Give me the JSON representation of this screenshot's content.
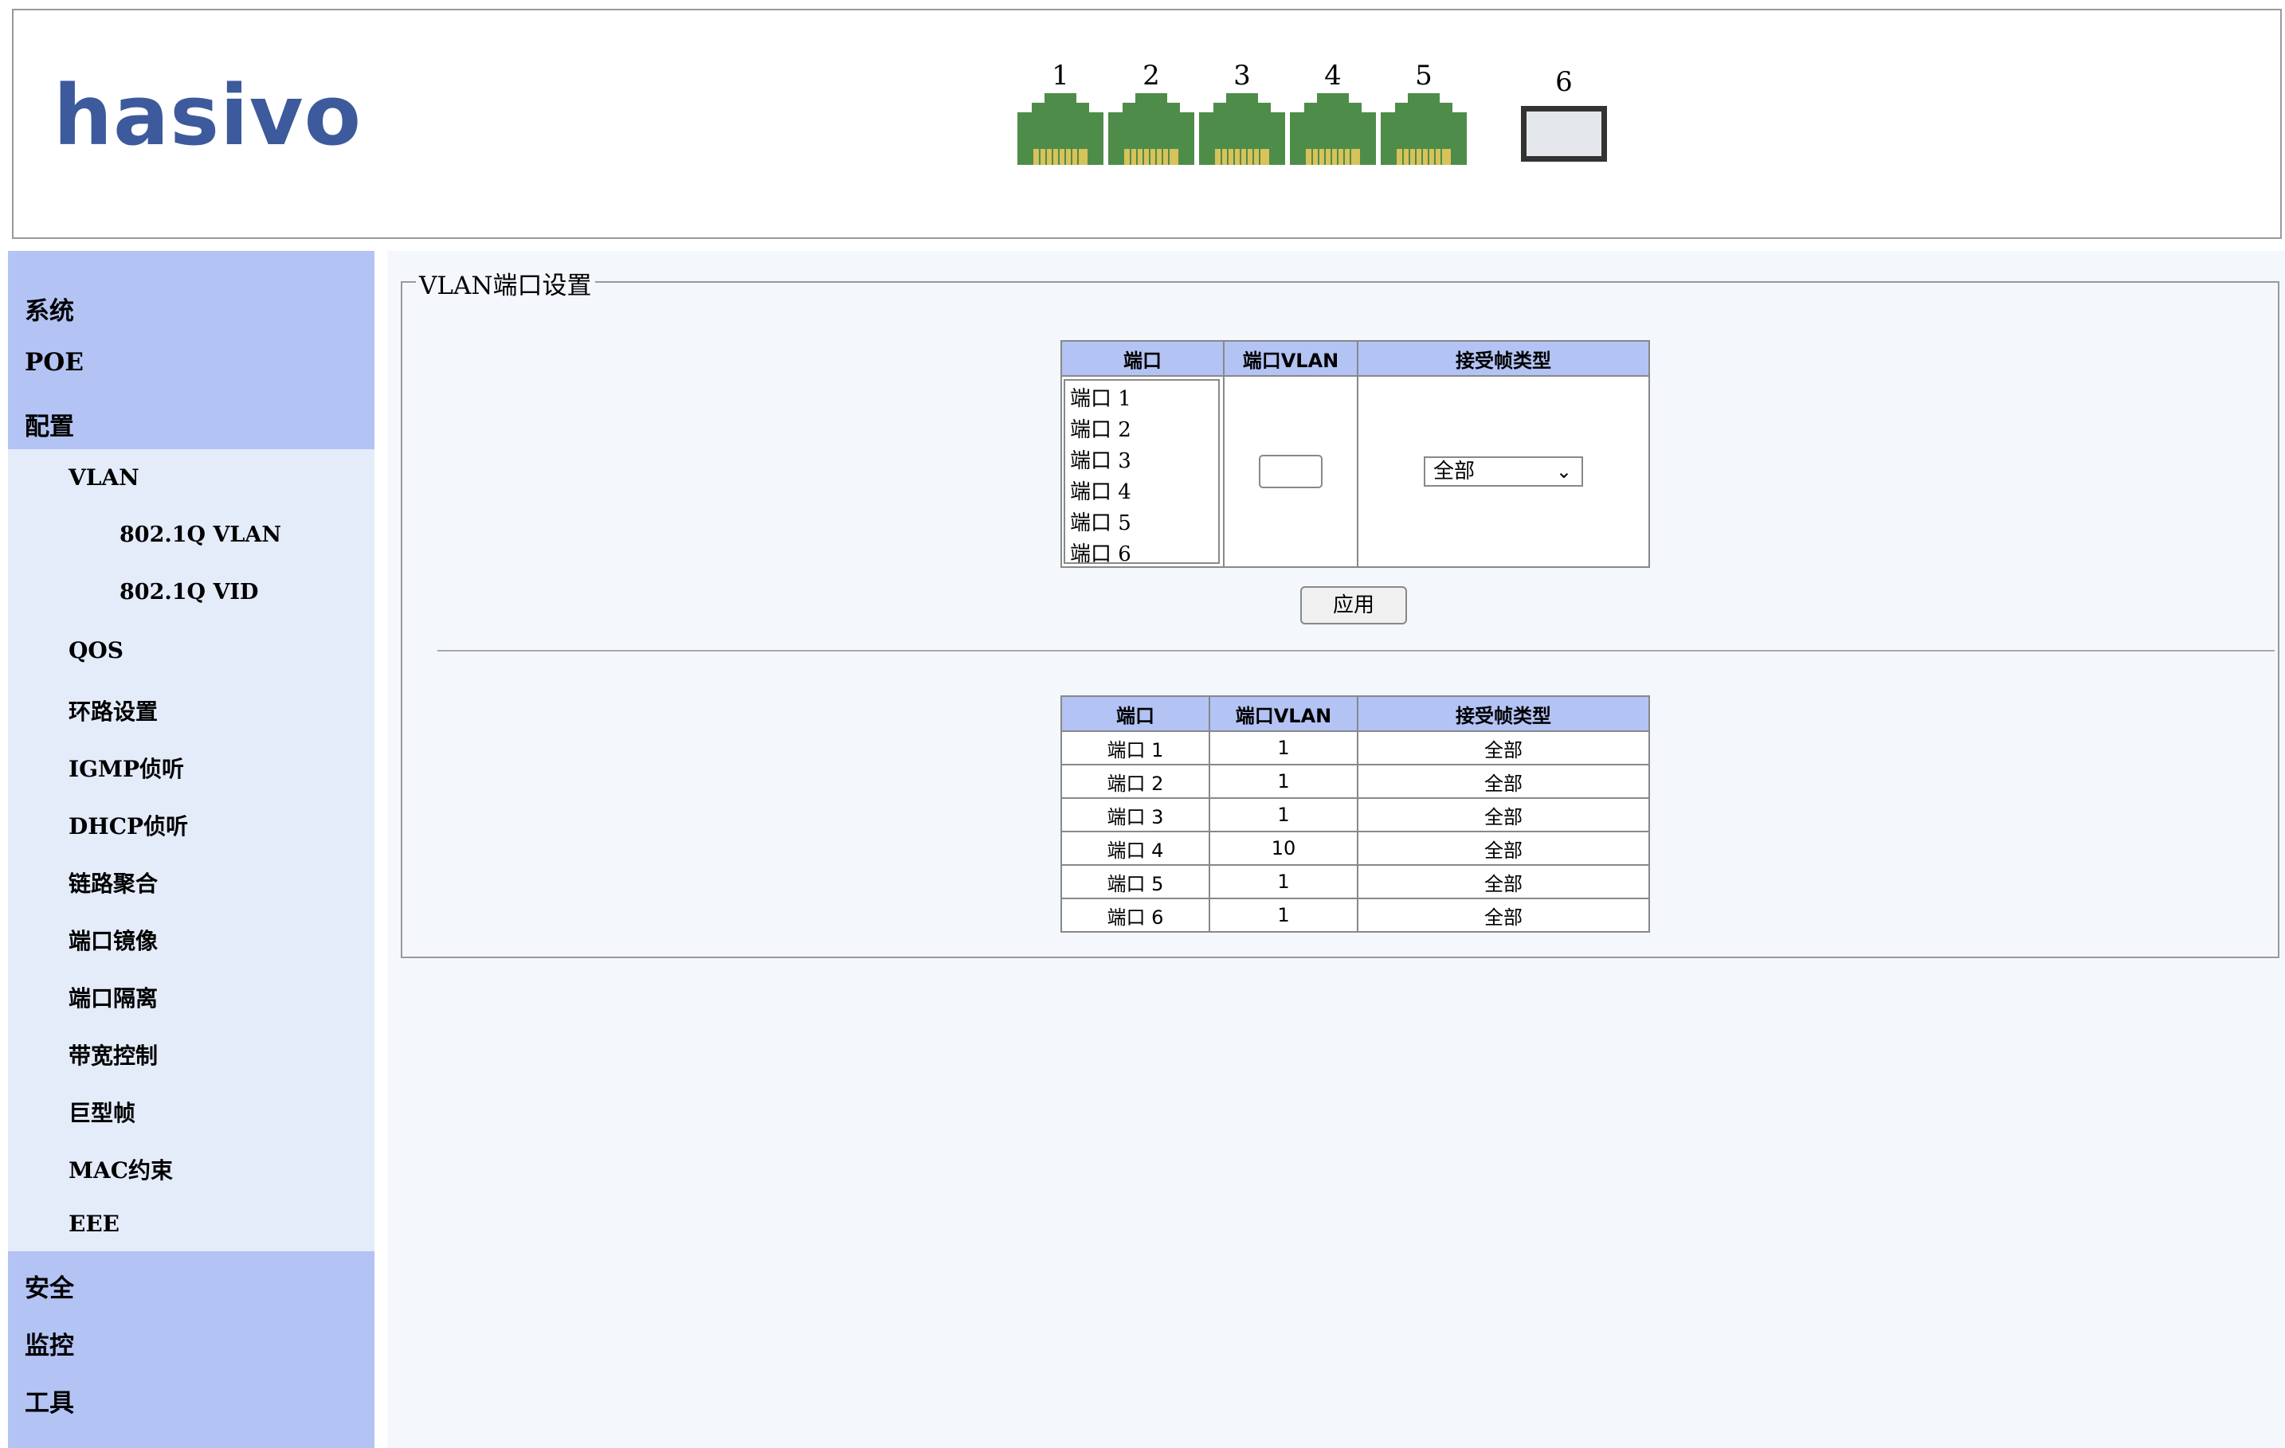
{
  "header": {
    "logo_text": "hasivo",
    "ports": [
      "1",
      "2",
      "3",
      "4",
      "5"
    ],
    "sfp_port": "6",
    "colors": {
      "rj45": "#4e8c4a",
      "pins": "#d8c25a"
    }
  },
  "sidebar": {
    "items": [
      {
        "label": "系统",
        "level": 1
      },
      {
        "label": "POE",
        "level": 1
      },
      {
        "label": "配置",
        "level": 1
      },
      {
        "label": "VLAN",
        "level": 2
      },
      {
        "label": "802.1Q VLAN",
        "level": 3
      },
      {
        "label": "802.1Q VID",
        "level": 3
      },
      {
        "label": "QOS",
        "level": 2
      },
      {
        "label": "环路设置",
        "level": 2
      },
      {
        "label": "IGMP侦听",
        "level": 2
      },
      {
        "label": "DHCP侦听",
        "level": 2
      },
      {
        "label": "链路聚合",
        "level": 2
      },
      {
        "label": "端口镜像",
        "level": 2
      },
      {
        "label": "端口隔离",
        "level": 2
      },
      {
        "label": "带宽控制",
        "level": 2
      },
      {
        "label": "巨型帧",
        "level": 2
      },
      {
        "label": "MAC约束",
        "level": 2
      },
      {
        "label": "EEE",
        "level": 2
      },
      {
        "label": "安全",
        "level": 1
      },
      {
        "label": "监控",
        "level": 1
      },
      {
        "label": "工具",
        "level": 1
      }
    ],
    "colors": {
      "section": "#b3c3f4",
      "sub": "#e4ebf9"
    }
  },
  "main": {
    "legend": "VLAN端口设置",
    "config": {
      "headers": [
        "端口",
        "端口VLAN",
        "接受帧类型"
      ],
      "port_options": [
        "端口 1",
        "端口 2",
        "端口 3",
        "端口 4",
        "端口 5",
        "端口 6"
      ],
      "vlan_value": "",
      "frame_type_selected": "全部"
    },
    "apply_label": "应用",
    "table": {
      "headers": [
        "端口",
        "端口VLAN",
        "接受帧类型"
      ],
      "rows": [
        [
          "端口 1",
          "1",
          "全部"
        ],
        [
          "端口 2",
          "1",
          "全部"
        ],
        [
          "端口 3",
          "1",
          "全部"
        ],
        [
          "端口 4",
          "10",
          "全部"
        ],
        [
          "端口 5",
          "1",
          "全部"
        ],
        [
          "端口 6",
          "1",
          "全部"
        ]
      ]
    }
  }
}
